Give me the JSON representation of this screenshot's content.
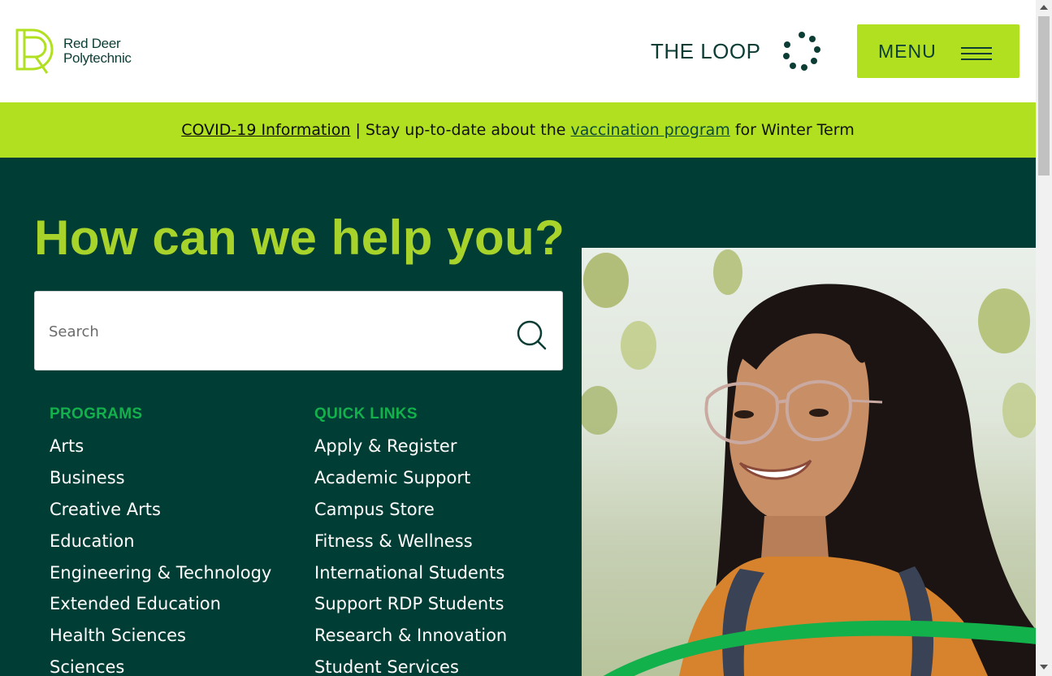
{
  "header": {
    "logo_line1": "Red Deer",
    "logo_line2": "Polytechnic",
    "loop_label": "THE LOOP",
    "menu_label": "MENU"
  },
  "alert": {
    "covid_link": "COVID-19 Information",
    "separator": "|",
    "text_before": "Stay up-to-date about the",
    "vaccination_link": "vaccination program",
    "text_after": "for Winter Term"
  },
  "hero": {
    "title": "How can we help you?",
    "search_placeholder": "Search"
  },
  "programs": {
    "heading": "PROGRAMS",
    "items": [
      "Arts",
      "Business",
      "Creative Arts",
      "Education",
      "Engineering & Technology",
      "Extended Education",
      "Health Sciences",
      "Sciences"
    ]
  },
  "quick_links": {
    "heading": "QUICK LINKS",
    "items": [
      "Apply & Register",
      "Academic Support",
      "Campus Store",
      "Fitness & Wellness",
      "International Students",
      "Support RDP Students",
      "Research & Innovation",
      "Student Services"
    ]
  },
  "colors": {
    "brand_green": "#003d35",
    "lime": "#b0e01f",
    "heading_green": "#13b14c",
    "title_lime": "#a7d32b"
  },
  "icons": {
    "logo": "rdp-logo-icon",
    "loop": "loop-dots-icon",
    "menu": "hamburger-icon",
    "search": "search-icon"
  }
}
